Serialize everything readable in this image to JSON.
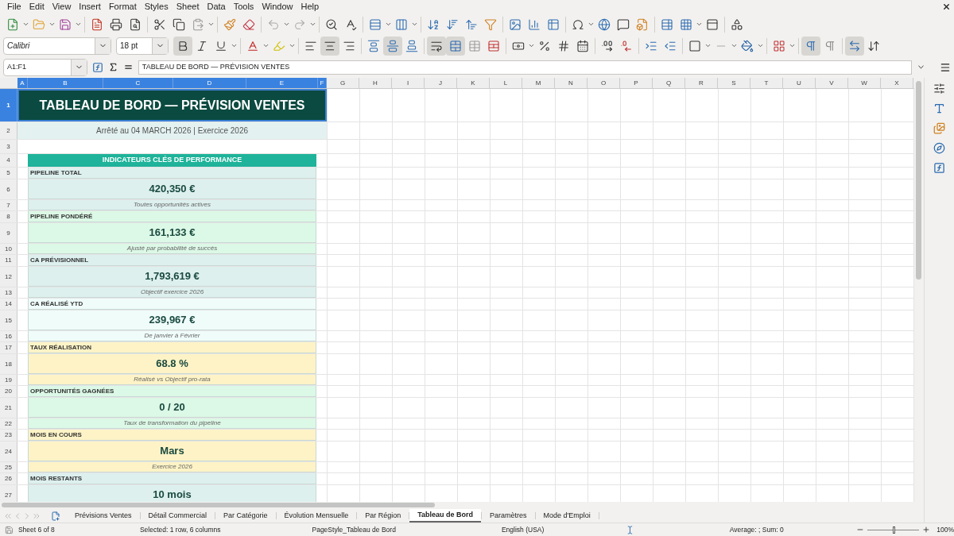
{
  "menu": [
    "File",
    "Edit",
    "View",
    "Insert",
    "Format",
    "Styles",
    "Sheet",
    "Data",
    "Tools",
    "Window",
    "Help"
  ],
  "font": {
    "name": "Calibri",
    "size": "18 pt"
  },
  "formatting": {
    "bold": true,
    "italic": false,
    "underline": false,
    "align_left": false,
    "align_center": true,
    "align_right": false,
    "align_top": false,
    "align_middle": true,
    "align_bottom": false,
    "wrap": true,
    "merge_center": true,
    "ltr": true,
    "rtl": false,
    "stacked": true
  },
  "formula_bar": {
    "name_box": "A1:F1",
    "content": "TABLEAU DE BORD — PRÉVISION VENTES"
  },
  "sheet": {
    "columns": [
      {
        "label": "A",
        "selected": true
      },
      {
        "label": "B",
        "selected": true
      },
      {
        "label": "C",
        "selected": true
      },
      {
        "label": "D",
        "selected": true
      },
      {
        "label": "E",
        "selected": true
      },
      {
        "label": "F",
        "selected": true
      },
      {
        "label": "G",
        "selected": false
      },
      {
        "label": "H",
        "selected": false
      },
      {
        "label": "I",
        "selected": false
      },
      {
        "label": "J",
        "selected": false
      },
      {
        "label": "K",
        "selected": false
      },
      {
        "label": "L",
        "selected": false
      },
      {
        "label": "M",
        "selected": false
      },
      {
        "label": "N",
        "selected": false
      },
      {
        "label": "O",
        "selected": false
      },
      {
        "label": "P",
        "selected": false
      },
      {
        "label": "Q",
        "selected": false
      },
      {
        "label": "R",
        "selected": false
      },
      {
        "label": "S",
        "selected": false
      },
      {
        "label": "T",
        "selected": false
      },
      {
        "label": "U",
        "selected": false
      },
      {
        "label": "V",
        "selected": false
      },
      {
        "label": "W",
        "selected": false
      },
      {
        "label": "X",
        "selected": false
      }
    ],
    "row_headers": [
      {
        "label": "1",
        "selected": true
      },
      {
        "label": "2",
        "selected": false
      },
      {
        "label": "3",
        "selected": false
      },
      {
        "label": "4",
        "selected": false
      },
      {
        "label": "5",
        "selected": false
      },
      {
        "label": "6",
        "selected": false
      },
      {
        "label": "7",
        "selected": false
      },
      {
        "label": "8",
        "selected": false
      },
      {
        "label": "9",
        "selected": false
      },
      {
        "label": "10",
        "selected": false
      },
      {
        "label": "11",
        "selected": false
      },
      {
        "label": "12",
        "selected": false
      },
      {
        "label": "13",
        "selected": false
      },
      {
        "label": "14",
        "selected": false
      },
      {
        "label": "15",
        "selected": false
      },
      {
        "label": "16",
        "selected": false
      },
      {
        "label": "17",
        "selected": false
      },
      {
        "label": "18",
        "selected": false
      },
      {
        "label": "19",
        "selected": false
      },
      {
        "label": "20",
        "selected": false
      },
      {
        "label": "21",
        "selected": false
      },
      {
        "label": "22",
        "selected": false
      },
      {
        "label": "23",
        "selected": false
      },
      {
        "label": "24",
        "selected": false
      },
      {
        "label": "25",
        "selected": false
      },
      {
        "label": "26",
        "selected": false
      },
      {
        "label": "27",
        "selected": false
      }
    ],
    "title": "TABLEAU DE BORD — PRÉVISION VENTES",
    "subtitle": "Arrêté au 04 MARCH 2026 |  Exercice 2026",
    "kpi_header": "INDICATEURS CLÉS DE PERFORMANCE",
    "kpis": [
      {
        "label": "PIPELINE TOTAL",
        "value": "420,350 €",
        "note": "Toutes opportunités actives",
        "color": "#ddf0ee"
      },
      {
        "label": "PIPELINE PONDÉRÉ",
        "value": "161,133 €",
        "note": "Ajusté par probabilité de succès",
        "color": "#dcf8e6"
      },
      {
        "label": "CA PRÉVISIONNEL",
        "value": "1,793,619 €",
        "note": "Objectif exercice 2026",
        "color": "#ddf0ee"
      },
      {
        "label": "CA RÉALISÉ YTD",
        "value": "239,967 €",
        "note": "De janvier à Février",
        "color": "#effcfa"
      },
      {
        "label": "TAUX RÉALISATION",
        "value": "68.8 %",
        "note": "Réalisé vs Objectif pro-rata",
        "color": "#fdf3c6"
      },
      {
        "label": "OPPORTUNITÉS GAGNÉES",
        "value": "0 / 20",
        "note": "Taux de transformation du pipeline",
        "color": "#dcf8e6"
      },
      {
        "label": "MOIS EN COURS",
        "value": "Mars",
        "note": "Exercice 2026",
        "color": "#fdf3c6"
      },
      {
        "label": "MOIS RESTANTS",
        "value": "10 mois",
        "color": "#ddf0ee"
      }
    ]
  },
  "tabs": [
    {
      "label": "Prévisions Ventes",
      "selected": false
    },
    {
      "label": "Détail Commercial",
      "selected": false
    },
    {
      "label": "Par Catégorie",
      "selected": false
    },
    {
      "label": "Évolution Mensuelle",
      "selected": false
    },
    {
      "label": "Par Région",
      "selected": false
    },
    {
      "label": "Tableau de Bord",
      "selected": true
    },
    {
      "label": "Paramètres",
      "selected": false
    },
    {
      "label": "Mode d'Emploi",
      "selected": false
    }
  ],
  "status_bar": {
    "sheet": "Sheet 6 of 8",
    "selection": "Selected: 1 row, 6 columns",
    "page_style": "PageStyle_Tableau de Bord",
    "language": "English (USA)",
    "sum": "Average: ; Sum: 0",
    "zoom": "100%",
    "zoom_slider": {
      "level": 0.5
    }
  }
}
